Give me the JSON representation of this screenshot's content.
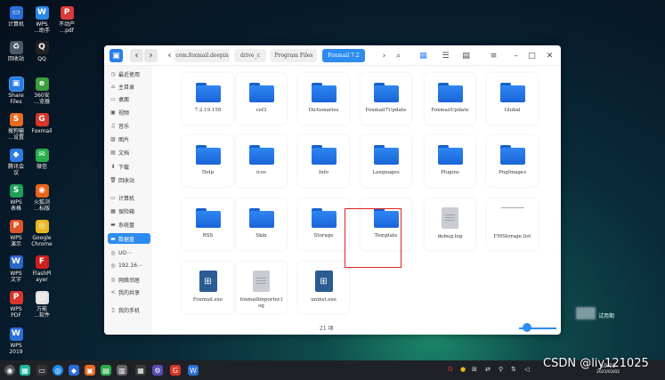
{
  "desktop": {
    "icons": [
      {
        "label": "计算机",
        "color": "#2a6fd6",
        "glyph": "▭"
      },
      {
        "label": "WPS\n…助手",
        "color": "#2b8ae6",
        "glyph": "W"
      },
      {
        "label": "不动产\n…pdf",
        "color": "#d93a3a",
        "glyph": "P"
      },
      {
        "label": "回收站",
        "color": "#4c5a66",
        "glyph": "♻"
      },
      {
        "label": "QQ",
        "color": "#222222",
        "glyph": "Q"
      },
      {
        "label": "Share\nFiles",
        "color": "#2a7de0",
        "glyph": "▣"
      },
      {
        "label": "360安\n…览器",
        "color": "#3c9e3c",
        "glyph": "e"
      },
      {
        "label": "搜狗输\n…设置",
        "color": "#e86a1f",
        "glyph": "S"
      },
      {
        "label": "Foxmail",
        "color": "#d8362b",
        "glyph": "G"
      },
      {
        "label": "腾讯会\n议",
        "color": "#2d7be5",
        "glyph": "◆"
      },
      {
        "label": "微信",
        "color": "#2aae4a",
        "glyph": "✉"
      },
      {
        "label": "WPS\n表格",
        "color": "#1e9e5a",
        "glyph": "S"
      },
      {
        "label": "火狐浏\n…标版",
        "color": "#e8631c",
        "glyph": "◉"
      },
      {
        "label": "WPS\n演示",
        "color": "#e0552a",
        "glyph": "P"
      },
      {
        "label": "Google\nChrome",
        "color": "#e8b620",
        "glyph": "◎"
      },
      {
        "label": "WPS\n文字",
        "color": "#2b66c9",
        "glyph": "W"
      },
      {
        "label": "FlashPl\nayer",
        "color": "#cc1f1f",
        "glyph": "F"
      },
      {
        "label": "WPS\nPDF",
        "color": "#d8362b",
        "glyph": "P"
      },
      {
        "label": "万能\n…软件",
        "color": "#e4e4e4",
        "glyph": "◫"
      },
      {
        "label": "WPS\n2019",
        "color": "#2b6fd6",
        "glyph": "W"
      }
    ]
  },
  "window": {
    "breadcrumbs": [
      "com.foxmail.deepin",
      "drive_c",
      "Program Files",
      "Foxmail 7.2"
    ],
    "sidebar": [
      {
        "label": "最近使用",
        "icon": "clock-icon",
        "glyph": "◷"
      },
      {
        "label": "主目录",
        "icon": "home-icon",
        "glyph": "⌂"
      },
      {
        "label": "桌面",
        "icon": "desktop-icon",
        "glyph": "▭"
      },
      {
        "label": "视频",
        "icon": "video-icon",
        "glyph": "▣"
      },
      {
        "label": "音乐",
        "icon": "music-icon",
        "glyph": "♫"
      },
      {
        "label": "图片",
        "icon": "picture-icon",
        "glyph": "▨"
      },
      {
        "label": "文档",
        "icon": "document-icon",
        "glyph": "▤"
      },
      {
        "label": "下载",
        "icon": "download-icon",
        "glyph": "⬇"
      },
      {
        "label": "回收站",
        "icon": "trash-icon",
        "glyph": "🗑"
      },
      {
        "label": "计算机",
        "icon": "computer-icon",
        "glyph": "▭"
      },
      {
        "label": "保险箱",
        "icon": "safe-icon",
        "glyph": "▦"
      },
      {
        "label": "系统盘",
        "icon": "disk-icon",
        "glyph": "▬"
      },
      {
        "label": "数据盘",
        "icon": "disk-icon",
        "glyph": "▬"
      },
      {
        "label": "UO⋯",
        "icon": "usb-icon",
        "glyph": "◎"
      },
      {
        "label": "192.16⋯",
        "icon": "network-icon",
        "glyph": "◎"
      },
      {
        "label": "网络邻居",
        "icon": "network-neighborhood-icon",
        "glyph": "◎"
      },
      {
        "label": "我的共享",
        "icon": "share-icon",
        "glyph": "<"
      },
      {
        "label": "我的手机",
        "icon": "phone-icon",
        "glyph": "▯"
      }
    ],
    "files": [
      {
        "name": "7.2.19.158",
        "kind": "folder"
      },
      {
        "name": "cef3",
        "kind": "folder"
      },
      {
        "name": "Dictionaries",
        "kind": "folder"
      },
      {
        "name": "Foxmail7Update",
        "kind": "folder"
      },
      {
        "name": "FoxmailUpdate",
        "kind": "folder"
      },
      {
        "name": "Global",
        "kind": "folder"
      },
      {
        "name": "Help",
        "kind": "folder"
      },
      {
        "name": "icos",
        "kind": "folder"
      },
      {
        "name": "Info",
        "kind": "folder"
      },
      {
        "name": "Languages",
        "kind": "folder"
      },
      {
        "name": "Plugins",
        "kind": "folder"
      },
      {
        "name": "PngImages",
        "kind": "folder"
      },
      {
        "name": "RSS",
        "kind": "folder"
      },
      {
        "name": "Skin",
        "kind": "folder"
      },
      {
        "name": "Storage",
        "kind": "folder"
      },
      {
        "name": "Template",
        "kind": "folder"
      },
      {
        "name": "debug.log",
        "kind": "doc"
      },
      {
        "name": "FMStorage.list",
        "kind": "blank"
      },
      {
        "name": "Foxmail.exe",
        "kind": "exe"
      },
      {
        "name": "foxmailimporter.l\nog",
        "kind": "doc"
      },
      {
        "name": "uninst.exe",
        "kind": "exe"
      }
    ],
    "status_count": "21 项"
  },
  "trial_text": "试用期",
  "clock": {
    "time": "10:02",
    "date": "2023/03/02"
  },
  "watermark": "CSDN @liy121025"
}
